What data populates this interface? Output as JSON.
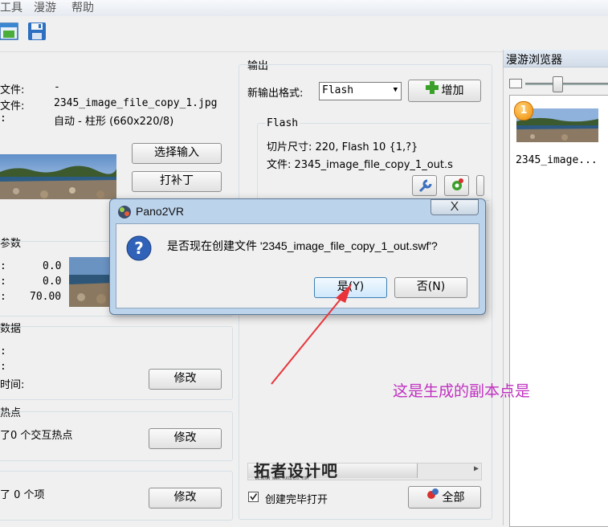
{
  "menu": {
    "tools": "工具",
    "tour": "漫游",
    "help": "帮助"
  },
  "input": {
    "file_label_1": "文件:",
    "file_value_1": "-",
    "file_label_2": "文件:",
    "file_value_2": "2345_image_file_copy_1.jpg",
    "type_prefix": ":",
    "type_value": "自动 - 柱形 (660x220/8)",
    "select_input": "选择输入",
    "patch": "打补丁"
  },
  "params": {
    "title": "参数",
    "r1_value": "0.0",
    "r2_value": "0.0",
    "r3_value": "70.00",
    "colon": ":"
  },
  "data_section": {
    "title": "数据",
    "time_label": "时间:",
    "modify": "修改",
    "colon": ":"
  },
  "hotspots": {
    "title": "热点",
    "text": "了0 个交互热点",
    "modify": "修改"
  },
  "media": {
    "text": "了 0 个项",
    "modify": "修改"
  },
  "output": {
    "title": "输出",
    "new_format_label": "新输出格式:",
    "format_selected": "Flash",
    "add_button": "增加",
    "flash_group_title": "Flash",
    "tile_size": "切片尺寸: 220, Flash 10 {1,?}",
    "file": "文件: 2345_image_file_copy_1_out.s",
    "open_after_create": "创建完毕打开",
    "all_button": "全部"
  },
  "tour_browser": {
    "title": "漫游浏览器",
    "item_label": "2345_image...",
    "badge": "1"
  },
  "dialog": {
    "title": "Pano2VR",
    "message": "是否现在创建文件 '2345_image_file_copy_1_out.swf'?",
    "yes": "是(Y)",
    "no": "否(N)",
    "close": "X"
  },
  "annotation": "这是生成的副本点是",
  "watermark": {
    "main": "拓者设计吧",
    "sub": "DESIGN WWW.TUOZHE8.COM"
  },
  "colors": {
    "annotation": "#c030c0",
    "arrow": "#e8343a",
    "accent_green": "#3aa02a"
  }
}
